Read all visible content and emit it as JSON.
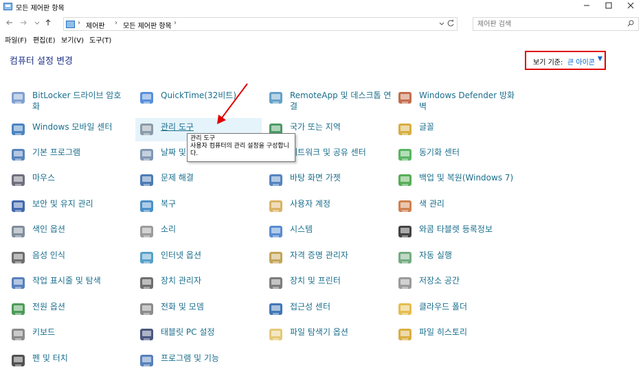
{
  "window": {
    "title": "모든 제어판 항목",
    "minimize_icon": "minimize-icon",
    "maximize_icon": "maximize-icon",
    "close_icon": "close-icon"
  },
  "address_bar": {
    "breadcrumbs": [
      "제어판",
      "모든 제어판 항목"
    ],
    "search_placeholder": "제어판 검색"
  },
  "menu": [
    "파일(F)",
    "편집(E)",
    "보기(V)",
    "도구(T)"
  ],
  "header": {
    "title": "컴퓨터 설정 변경",
    "view_by_label": "보기 기준:",
    "view_by_value": "큰 아이콘"
  },
  "items": [
    {
      "label": "BitLocker 드라이브 암호화",
      "icon": "bitlocker-icon"
    },
    {
      "label": "QuickTime(32비트)",
      "icon": "quicktime-icon"
    },
    {
      "label": "RemoteApp 및 데스크톱 연결",
      "icon": "remoteapp-icon"
    },
    {
      "label": "Windows Defender 방화벽",
      "icon": "firewall-icon"
    },
    {
      "label": "Windows 모바일 센터",
      "icon": "mobility-center-icon"
    },
    {
      "label": "관리 도구",
      "icon": "admin-tools-icon"
    },
    {
      "label": "국가 또는 지역",
      "icon": "region-icon"
    },
    {
      "label": "글꼴",
      "icon": "fonts-icon"
    },
    {
      "label": "기본 프로그램",
      "icon": "default-programs-icon"
    },
    {
      "label": "날짜 및 시간",
      "icon": "date-time-icon"
    },
    {
      "label": "네트워크 및 공유 센터",
      "icon": "network-icon"
    },
    {
      "label": "동기화 센터",
      "icon": "sync-center-icon"
    },
    {
      "label": "마우스",
      "icon": "mouse-icon"
    },
    {
      "label": "문제 해결",
      "icon": "troubleshoot-icon"
    },
    {
      "label": "바탕 화면 가젯",
      "icon": "gadgets-icon"
    },
    {
      "label": "백업 및 복원(Windows 7)",
      "icon": "backup-icon"
    },
    {
      "label": "보안 및 유지 관리",
      "icon": "security-flag-icon"
    },
    {
      "label": "복구",
      "icon": "recovery-icon"
    },
    {
      "label": "사용자 계정",
      "icon": "user-accounts-icon"
    },
    {
      "label": "색 관리",
      "icon": "color-management-icon"
    },
    {
      "label": "색인 옵션",
      "icon": "indexing-icon"
    },
    {
      "label": "소리",
      "icon": "sound-icon"
    },
    {
      "label": "시스템",
      "icon": "system-icon"
    },
    {
      "label": "와콤 타블렛 등록정보",
      "icon": "wacom-tablet-icon"
    },
    {
      "label": "음성 인식",
      "icon": "microphone-icon"
    },
    {
      "label": "인터넷 옵션",
      "icon": "internet-options-icon"
    },
    {
      "label": "자격 증명 관리자",
      "icon": "credential-manager-icon"
    },
    {
      "label": "자동 실행",
      "icon": "autoplay-icon"
    },
    {
      "label": "작업 표시줄 및 탐색",
      "icon": "taskbar-icon"
    },
    {
      "label": "장치 관리자",
      "icon": "device-manager-icon"
    },
    {
      "label": "장치 및 프린터",
      "icon": "printer-icon"
    },
    {
      "label": "저장소 공간",
      "icon": "storage-spaces-icon"
    },
    {
      "label": "전원 옵션",
      "icon": "power-options-icon"
    },
    {
      "label": "전화 및 모뎀",
      "icon": "phone-modem-icon"
    },
    {
      "label": "접근성 센터",
      "icon": "ease-of-access-icon"
    },
    {
      "label": "클라우드 폴더",
      "icon": "work-folders-icon"
    },
    {
      "label": "키보드",
      "icon": "keyboard-icon"
    },
    {
      "label": "태블릿 PC 설정",
      "icon": "tablet-pc-icon"
    },
    {
      "label": "파일 탐색기 옵션",
      "icon": "folder-options-icon"
    },
    {
      "label": "파일 히스토리",
      "icon": "file-history-icon"
    },
    {
      "label": "펜 및 터치",
      "icon": "pen-touch-icon"
    },
    {
      "label": "프로그램 및 기능",
      "icon": "programs-features-icon"
    }
  ],
  "tooltip": {
    "title": "관리 도구",
    "description": "사용자 컴퓨터의 관리 설정을 구성합니다."
  },
  "colors": {
    "link": "#1a6e8c",
    "header": "#1e3287",
    "highlight_box": "#e00000",
    "annotation_arrow": "#e00000"
  }
}
